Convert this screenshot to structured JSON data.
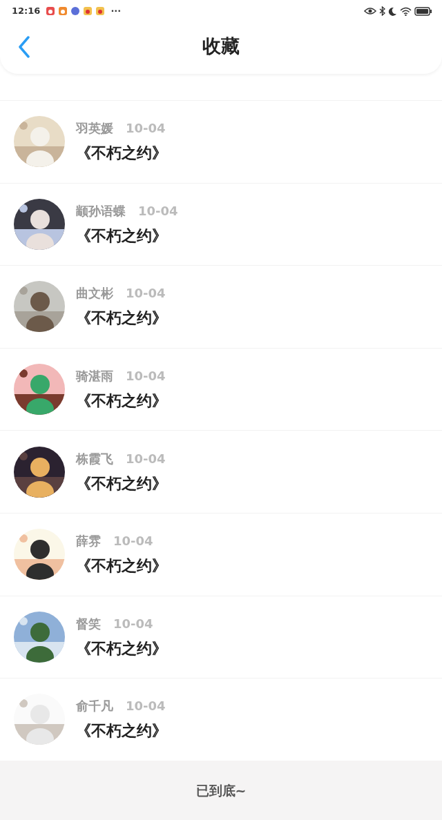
{
  "status_bar": {
    "time": "12:16",
    "more": "···"
  },
  "header": {
    "title": "收藏"
  },
  "items": [
    {
      "name": "羽英媛",
      "date": "10-04",
      "title": "《不朽之约》"
    },
    {
      "name": "颛孙语蝶",
      "date": "10-04",
      "title": "《不朽之约》"
    },
    {
      "name": "曲文彬",
      "date": "10-04",
      "title": "《不朽之约》"
    },
    {
      "name": "骑湛雨",
      "date": "10-04",
      "title": "《不朽之约》"
    },
    {
      "name": "栋霞飞",
      "date": "10-04",
      "title": "《不朽之约》"
    },
    {
      "name": "薛雰",
      "date": "10-04",
      "title": "《不朽之约》"
    },
    {
      "name": "督笑",
      "date": "10-04",
      "title": "《不朽之约》"
    },
    {
      "name": "俞千凡",
      "date": "10-04",
      "title": "《不朽之约》"
    }
  ],
  "footer": {
    "text": "已到底~"
  }
}
